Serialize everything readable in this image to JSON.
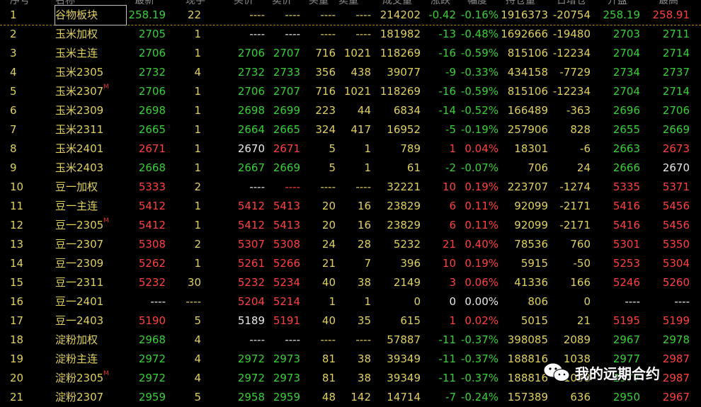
{
  "header": {
    "labels": [
      "序号",
      "名称",
      "最新",
      "现手",
      "买价",
      "卖价",
      "买量",
      "卖量",
      "成交量",
      "涨跌",
      "幅度",
      "持仓量",
      "日增仓",
      "开盘",
      "最高"
    ]
  },
  "watermark": {
    "text": "我的远期合约"
  },
  "rows": [
    {
      "idx": "1",
      "name": "谷物板块",
      "badge": "",
      "c": [
        "258.19",
        "22",
        "----",
        "----",
        "----",
        "----",
        "214202",
        "-0.42",
        "-0.16%",
        "1916373",
        "-20754",
        "258.19",
        "258.91"
      ],
      "col": [
        "g",
        "y",
        "y",
        "y",
        "y",
        "y",
        "y",
        "g",
        "g",
        "y",
        "y",
        "g",
        "rd"
      ]
    },
    {
      "idx": "2",
      "name": "玉米加权",
      "badge": "",
      "c": [
        "2705",
        "1",
        "----",
        "----",
        "----",
        "----",
        "181982",
        "-13",
        "-0.48%",
        "1692666",
        "-19480",
        "2703",
        "2711"
      ],
      "col": [
        "g",
        "y",
        "w",
        "w",
        "y",
        "y",
        "y",
        "g",
        "g",
        "y",
        "y",
        "g",
        "g"
      ]
    },
    {
      "idx": "3",
      "name": "玉米主连",
      "badge": "",
      "c": [
        "2706",
        "1",
        "2706",
        "2707",
        "716",
        "1021",
        "118269",
        "-16",
        "-0.59%",
        "815106",
        "-12234",
        "2704",
        "2714"
      ],
      "col": [
        "g",
        "y",
        "g",
        "g",
        "y",
        "y",
        "y",
        "g",
        "g",
        "y",
        "y",
        "g",
        "g"
      ]
    },
    {
      "idx": "4",
      "name": "玉米2305",
      "badge": "",
      "c": [
        "2732",
        "4",
        "2732",
        "2733",
        "356",
        "438",
        "39077",
        "-9",
        "-0.33%",
        "434158",
        "-7729",
        "2734",
        "2737"
      ],
      "col": [
        "g",
        "y",
        "g",
        "g",
        "y",
        "y",
        "y",
        "g",
        "g",
        "y",
        "y",
        "g",
        "g"
      ]
    },
    {
      "idx": "5",
      "name": "玉米2307",
      "badge": "M",
      "c": [
        "2706",
        "1",
        "2706",
        "2707",
        "716",
        "1021",
        "118269",
        "-16",
        "-0.59%",
        "815106",
        "-12234",
        "2704",
        "2714"
      ],
      "col": [
        "g",
        "y",
        "g",
        "g",
        "y",
        "y",
        "y",
        "g",
        "g",
        "y",
        "y",
        "g",
        "g"
      ]
    },
    {
      "idx": "6",
      "name": "玉米2309",
      "badge": "",
      "c": [
        "2698",
        "1",
        "2698",
        "2699",
        "223",
        "44",
        "6834",
        "-14",
        "-0.52%",
        "166489",
        "-363",
        "2696",
        "2706"
      ],
      "col": [
        "g",
        "y",
        "g",
        "g",
        "y",
        "y",
        "y",
        "g",
        "g",
        "y",
        "y",
        "g",
        "g"
      ]
    },
    {
      "idx": "7",
      "name": "玉米2311",
      "badge": "",
      "c": [
        "2665",
        "1",
        "2664",
        "2665",
        "324",
        "417",
        "16952",
        "-5",
        "-0.19%",
        "257906",
        "828",
        "2655",
        "2669"
      ],
      "col": [
        "g",
        "y",
        "g",
        "g",
        "y",
        "y",
        "y",
        "g",
        "g",
        "y",
        "y",
        "g",
        "g"
      ]
    },
    {
      "idx": "8",
      "name": "玉米2401",
      "badge": "",
      "c": [
        "2671",
        "1",
        "2670",
        "2671",
        "5",
        "1",
        "789",
        "1",
        "0.04%",
        "18301",
        "-6",
        "2663",
        "2673"
      ],
      "col": [
        "rd",
        "y",
        "w",
        "rd",
        "y",
        "y",
        "y",
        "rd",
        "rd",
        "y",
        "y",
        "g",
        "rd"
      ]
    },
    {
      "idx": "9",
      "name": "玉米2403",
      "badge": "",
      "c": [
        "2668",
        "1",
        "2667",
        "2669",
        "5",
        "1",
        "61",
        "-2",
        "-0.07%",
        "706",
        "24",
        "2666",
        "2670"
      ],
      "col": [
        "g",
        "y",
        "g",
        "g",
        "y",
        "y",
        "y",
        "g",
        "g",
        "y",
        "y",
        "g",
        "w"
      ]
    },
    {
      "idx": "10",
      "name": "豆一加权",
      "badge": "",
      "c": [
        "5333",
        "2",
        "----",
        "----",
        "----",
        "----",
        "32221",
        "10",
        "0.19%",
        "223707",
        "-1274",
        "5335",
        "5371"
      ],
      "col": [
        "rd",
        "y",
        "w",
        "rd",
        "y",
        "y",
        "y",
        "rd",
        "rd",
        "y",
        "y",
        "rd",
        "rd"
      ]
    },
    {
      "idx": "11",
      "name": "豆一主连",
      "badge": "",
      "c": [
        "5412",
        "1",
        "5412",
        "5413",
        "20",
        "16",
        "23829",
        "6",
        "0.11%",
        "92099",
        "-2171",
        "5416",
        "5456"
      ],
      "col": [
        "rd",
        "y",
        "rd",
        "rd",
        "y",
        "y",
        "y",
        "rd",
        "rd",
        "y",
        "y",
        "rd",
        "rd"
      ]
    },
    {
      "idx": "12",
      "name": "豆一2305",
      "badge": "M",
      "c": [
        "5412",
        "1",
        "5412",
        "5413",
        "20",
        "16",
        "23829",
        "6",
        "0.11%",
        "92099",
        "-2171",
        "5416",
        "5456"
      ],
      "col": [
        "rd",
        "y",
        "rd",
        "rd",
        "y",
        "y",
        "y",
        "rd",
        "rd",
        "y",
        "y",
        "rd",
        "rd"
      ]
    },
    {
      "idx": "13",
      "name": "豆一2307",
      "badge": "",
      "c": [
        "5308",
        "2",
        "5307",
        "5308",
        "24",
        "28",
        "5232",
        "21",
        "0.40%",
        "78536",
        "760",
        "5301",
        "5350"
      ],
      "col": [
        "rd",
        "y",
        "rd",
        "rd",
        "y",
        "y",
        "y",
        "rd",
        "rd",
        "y",
        "y",
        "rd",
        "rd"
      ]
    },
    {
      "idx": "14",
      "name": "豆一2309",
      "badge": "",
      "c": [
        "5262",
        "1",
        "5261",
        "5266",
        "21",
        "7",
        "396",
        "10",
        "0.19%",
        "5915",
        "-50",
        "5253",
        "5304"
      ],
      "col": [
        "rd",
        "y",
        "rd",
        "rd",
        "y",
        "y",
        "y",
        "rd",
        "rd",
        "y",
        "y",
        "rd",
        "rd"
      ]
    },
    {
      "idx": "15",
      "name": "豆一2311",
      "badge": "",
      "c": [
        "5232",
        "30",
        "5232",
        "5234",
        "40",
        "38",
        "2149",
        "3",
        "0.06%",
        "41336",
        "166",
        "5246",
        "5260"
      ],
      "col": [
        "rd",
        "y",
        "rd",
        "rd",
        "y",
        "y",
        "y",
        "rd",
        "rd",
        "y",
        "y",
        "rd",
        "rd"
      ]
    },
    {
      "idx": "16",
      "name": "豆一2401",
      "badge": "",
      "c": [
        "----",
        "----",
        "5204",
        "5214",
        "1",
        "1",
        "0",
        "0",
        "0.00%",
        "806",
        "0",
        "----",
        "----"
      ],
      "col": [
        "w",
        "y",
        "rd",
        "rd",
        "y",
        "y",
        "y",
        "w",
        "w",
        "y",
        "y",
        "w",
        "w"
      ]
    },
    {
      "idx": "17",
      "name": "豆一2403",
      "badge": "",
      "c": [
        "5190",
        "5",
        "5189",
        "5191",
        "40",
        "35",
        "615",
        "1",
        "0.02%",
        "5015",
        "21",
        "5195",
        "5199"
      ],
      "col": [
        "rd",
        "y",
        "w",
        "rd",
        "y",
        "y",
        "y",
        "rd",
        "rd",
        "y",
        "y",
        "rd",
        "rd"
      ]
    },
    {
      "idx": "18",
      "name": "淀粉加权",
      "badge": "",
      "c": [
        "2968",
        "4",
        "----",
        "----",
        "----",
        "----",
        "57887",
        "-11",
        "-0.37%",
        "398085",
        "2089",
        "2967",
        "2978"
      ],
      "col": [
        "g",
        "y",
        "w",
        "w",
        "y",
        "y",
        "y",
        "g",
        "g",
        "y",
        "y",
        "g",
        "g"
      ]
    },
    {
      "idx": "19",
      "name": "淀粉主连",
      "badge": "",
      "c": [
        "2972",
        "4",
        "2972",
        "2973",
        "81",
        "38",
        "39349",
        "-11",
        "-0.37%",
        "188816",
        "1038",
        "2977",
        "2987"
      ],
      "col": [
        "g",
        "y",
        "g",
        "g",
        "y",
        "y",
        "y",
        "g",
        "g",
        "y",
        "y",
        "g",
        "rd"
      ]
    },
    {
      "idx": "20",
      "name": "淀粉2305",
      "badge": "M",
      "c": [
        "2972",
        "4",
        "2972",
        "2973",
        "81",
        "38",
        "39349",
        "-11",
        "-0.37%",
        "188816",
        "1038",
        "2977",
        "2987"
      ],
      "col": [
        "g",
        "y",
        "g",
        "g",
        "y",
        "y",
        "y",
        "g",
        "g",
        "y",
        "y",
        "g",
        "rd"
      ]
    },
    {
      "idx": "21",
      "name": "淀粉2307",
      "badge": "",
      "c": [
        "2959",
        "5",
        "2958",
        "2959",
        "48",
        "142",
        "14714",
        "-7",
        "-0.24%",
        "157389",
        "636",
        "2950",
        "2967"
      ],
      "col": [
        "g",
        "y",
        "g",
        "g",
        "y",
        "y",
        "y",
        "g",
        "g",
        "y",
        "y",
        "g",
        "rd"
      ]
    }
  ]
}
